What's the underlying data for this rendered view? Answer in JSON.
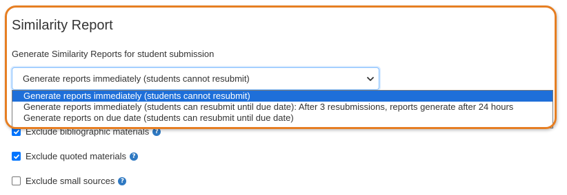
{
  "section": {
    "title": "Similarity Report",
    "field_label": "Generate Similarity Reports for student submission"
  },
  "select": {
    "selected_value": "Generate reports immediately (students cannot resubmit)",
    "options": [
      "Generate reports immediately (students cannot resubmit)",
      "Generate reports immediately (students can resubmit until due date): After 3 resubmissions, reports generate after 24 hours",
      "Generate reports on due date (students can resubmit until due date)"
    ],
    "highlighted_index": 0
  },
  "checkboxes": [
    {
      "label": "Exclude bibliographic materials",
      "checked": true,
      "help_icon": "question-circle-icon"
    },
    {
      "label": "Exclude quoted materials",
      "checked": true,
      "help_icon": "question-circle-icon"
    },
    {
      "label": "Exclude small sources",
      "checked": false,
      "help_icon": "question-circle-icon"
    }
  ],
  "colors": {
    "highlight_frame": "#e67e22",
    "selected_option": "#1e6fd9",
    "checkbox_checked": "#0075ff",
    "help_icon": "#2f79c2"
  }
}
